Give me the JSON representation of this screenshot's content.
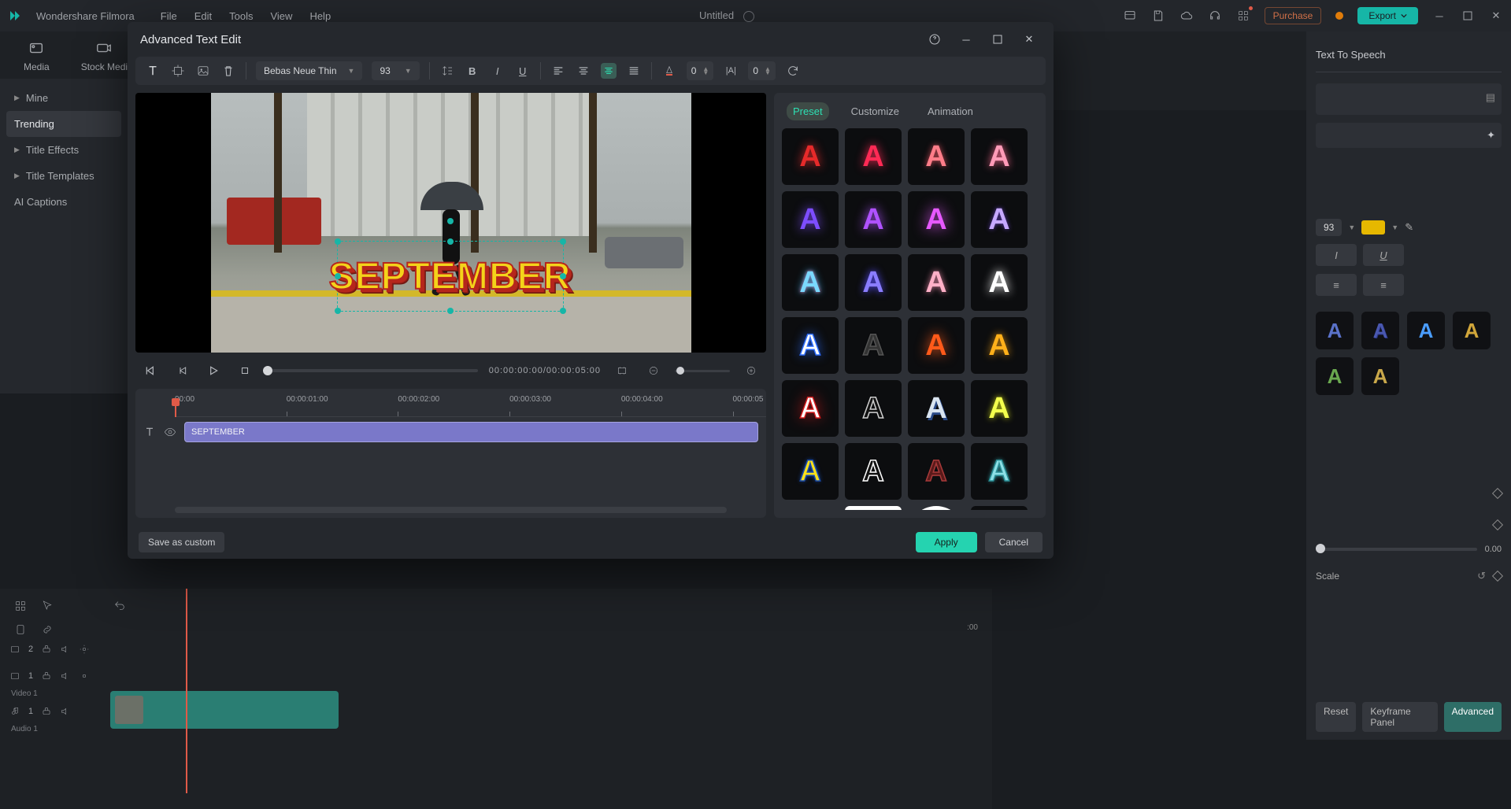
{
  "app": {
    "name": "Wondershare Filmora",
    "doc_title": "Untitled",
    "menus": [
      "File",
      "Edit",
      "Tools",
      "View",
      "Help"
    ],
    "purchase": "Purchase",
    "export": "Export"
  },
  "workspace_tabs": {
    "media": "Media",
    "stock": "Stock Medi"
  },
  "left_sidebar": {
    "items": [
      {
        "label": "Mine",
        "expandable": true
      },
      {
        "label": "Trending",
        "active": true
      },
      {
        "label": "Title Effects",
        "expandable": true
      },
      {
        "label": "Title Templates",
        "expandable": true
      },
      {
        "label": "AI Captions"
      }
    ]
  },
  "right_panel": {
    "title": "Text To Speech",
    "size_value": "93",
    "style_i": "I",
    "style_u": "U",
    "scale_label": "Scale",
    "scale_value": "0.00",
    "reset": "Reset",
    "keyframe_panel": "Keyframe Panel",
    "advanced": "Advanced"
  },
  "modal": {
    "title": "Advanced Text Edit",
    "toolbar": {
      "font_name": "Bebas Neue Thin",
      "font_size": "93",
      "spacing_value": "0",
      "tracking_value": "0"
    },
    "preview_text": "SEPTEMBER",
    "transport": {
      "timecode": "00:00:00:00/00:00:05:00"
    },
    "timeline": {
      "marks": [
        "00:00",
        "00:00:01:00",
        "00:00:02:00",
        "00:00:03:00",
        "00:00:04:00",
        "00:00:05"
      ],
      "clip_label": "SEPTEMBER"
    },
    "preset_tabs": {
      "preset": "Preset",
      "customize": "Customize",
      "animation": "Animation"
    },
    "footer": {
      "save_custom": "Save as custom",
      "apply": "Apply",
      "cancel": "Cancel"
    }
  },
  "bg_timeline": {
    "tracks": [
      {
        "badge": "2"
      },
      {
        "badge": "1",
        "label": "Video 1"
      },
      {
        "badge": "1",
        "label": "Audio 1"
      }
    ],
    "head_time": ":00"
  },
  "preset_styles": [
    {
      "color": "#e62a2a",
      "shadow": "0 0 12px #e62a2a"
    },
    {
      "color": "#ff2a55",
      "shadow": "0 0 12px #ff2a55"
    },
    {
      "color": "#ff7d89",
      "shadow": "0 0 8px #c94a57"
    },
    {
      "color": "#ff9bb8",
      "shadow": "0 0 10px #ff6a92"
    },
    {
      "color": "#7d4dff",
      "shadow": "0 0 14px #7d4dff"
    },
    {
      "color": "#b052ff",
      "shadow": "0 0 14px #b052ff"
    },
    {
      "color": "#e659ff",
      "shadow": "0 0 18px #e659ff"
    },
    {
      "color": "#c6a9ff",
      "shadow": "0 0 6px #5a3aa8"
    },
    {
      "color": "#7ad8ff",
      "shadow": "0 0 10px #3a9ed1,0 0 4px #ff8ac4"
    },
    {
      "color": "#8a7dff",
      "shadow": "0 0 10px #5a4dff"
    },
    {
      "color": "#ffb0c7",
      "shadow": "0 0 8px #d17a96"
    },
    {
      "color": "#ffffff",
      "shadow": "0 0 12px #ffffff"
    },
    {
      "color": "#ffffff",
      "shadow": "0 0 14px #2c6cff",
      "stroke": "#2c6cff"
    },
    {
      "color": "#333333",
      "shadow": "0 0 2px #000",
      "stroke": "#555"
    },
    {
      "color": "#ff5a1a",
      "shadow": "0 0 16px #ff5a1a"
    },
    {
      "color": "#ffb01a",
      "shadow": "0 0 10px #d18a12"
    },
    {
      "color": "#ffffff",
      "shadow": "0 0 18px #d11a1a",
      "stroke": "#d11a1a"
    },
    {
      "color": "#111111",
      "shadow": "none",
      "stroke": "#cfcfcf"
    },
    {
      "color": "#d9e4f0",
      "shadow": "2px 3px 0 #2a4a88"
    },
    {
      "color": "#f3ff4d",
      "shadow": "0 0 8px #c8d11a"
    },
    {
      "color": "#ffe21a",
      "shadow": "0 0 6px #1a4db0",
      "stroke": "#1a4db0"
    },
    {
      "color": "#111111",
      "shadow": "none",
      "stroke": "#ffffff"
    },
    {
      "color": "#5a1a1a",
      "shadow": "none",
      "stroke": "#a83a3a"
    },
    {
      "color": "#8de0e6",
      "shadow": "0 0 6px #3ab0b8",
      "stroke": "#2a8f96"
    },
    {
      "color": "#ffb01a",
      "shadow": "0 0 10px #ff7d1a",
      "grad": "linear-gradient(#ffe21a,#ff6a1a)"
    },
    {
      "color": "#ffffff",
      "shadow": "none",
      "bg": "#ffffff",
      "inverse": true
    },
    {
      "color": "#000000",
      "shadow": "none",
      "bg": "#ffffff",
      "round": true
    },
    {
      "color": "#ffffff",
      "shadow": "none",
      "hatch": true
    }
  ]
}
